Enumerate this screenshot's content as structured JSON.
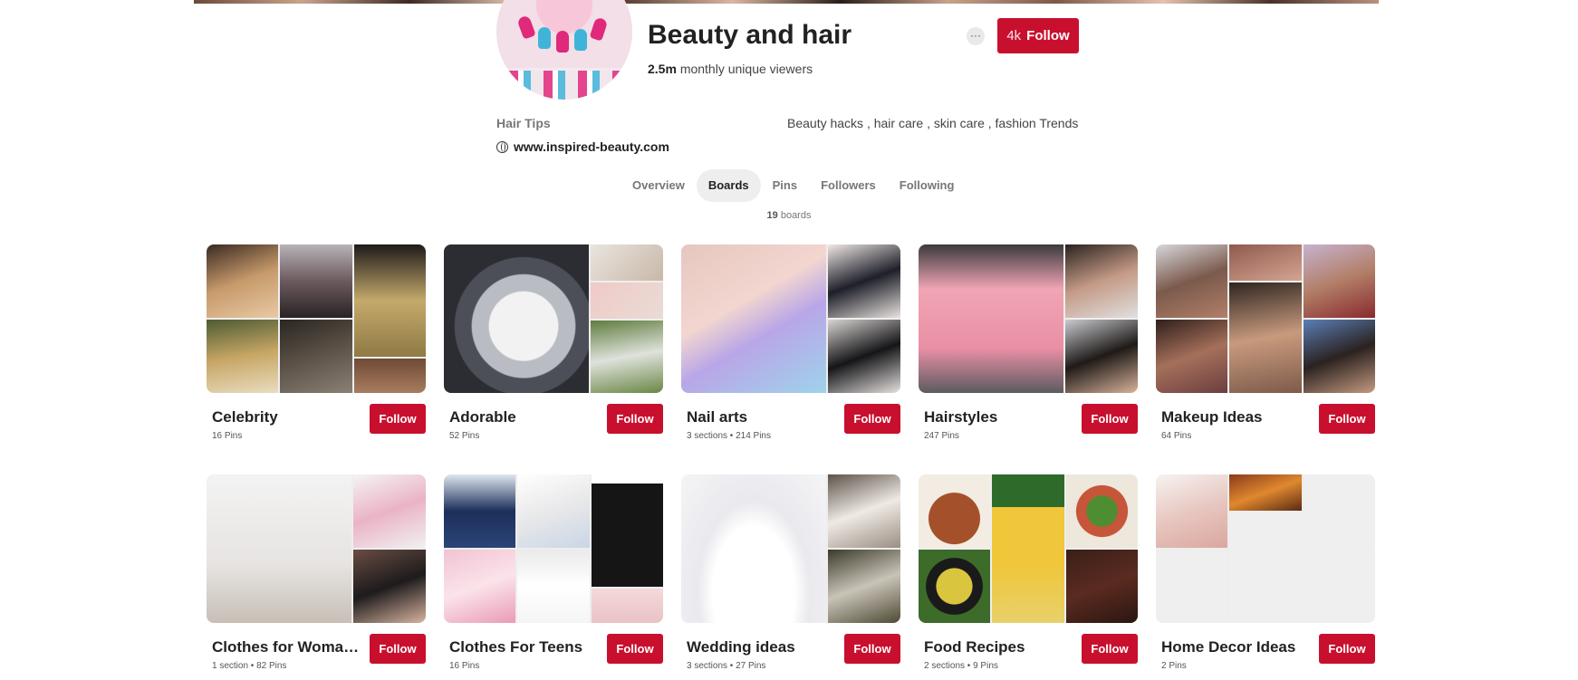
{
  "profile": {
    "title": "Beauty and hair",
    "viewers_count": "2.5m",
    "viewers_label": "monthly unique viewers",
    "more_icon": "···",
    "follower_count": "4k",
    "follow_label": "Follow",
    "left_description": "Hair Tips",
    "right_description": "Beauty hacks , hair care , skin care , fashion Trends",
    "website": "www.inspired-beauty.com"
  },
  "tabs": [
    {
      "label": "Overview"
    },
    {
      "label": "Boards"
    },
    {
      "label": "Pins"
    },
    {
      "label": "Followers"
    },
    {
      "label": "Following"
    }
  ],
  "boards_summary": {
    "count": "19",
    "label": "boards"
  },
  "boards": [
    {
      "name": "Celebrity",
      "meta": "16 Pins",
      "follow": "Follow"
    },
    {
      "name": "Adorable",
      "meta": "52 Pins",
      "follow": "Follow"
    },
    {
      "name": "Nail arts",
      "meta": "3 sections • 214 Pins",
      "follow": "Follow"
    },
    {
      "name": "Hairstyles",
      "meta": "247 Pins",
      "follow": "Follow"
    },
    {
      "name": "Makeup Ideas",
      "meta": "64 Pins",
      "follow": "Follow"
    },
    {
      "name": "Clothes for Woman ...",
      "meta": "1 section • 82 Pins",
      "follow": "Follow"
    },
    {
      "name": "Clothes For Teens",
      "meta": "16 Pins",
      "follow": "Follow"
    },
    {
      "name": "Wedding ideas",
      "meta": "3 sections • 27 Pins",
      "follow": "Follow"
    },
    {
      "name": "Food Recipes",
      "meta": "2 sections • 9 Pins",
      "follow": "Follow"
    },
    {
      "name": "Home Decor Ideas",
      "meta": "2 Pins",
      "follow": "Follow"
    }
  ],
  "colors": {
    "accent": "#c8102e",
    "tab_active_bg": "#eeeeee"
  }
}
